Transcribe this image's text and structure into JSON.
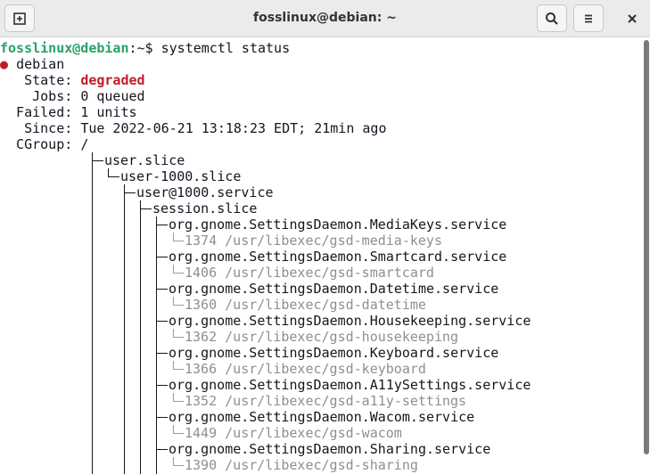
{
  "window": {
    "title": "fosslinux@debian: ~"
  },
  "terminal": {
    "prompt_user": "fosslinux@debian",
    "prompt_suffix": ":~$ ",
    "command": "systemctl status",
    "host_line": "debian",
    "status_fields": [
      {
        "label": "   State: ",
        "value": "degraded"
      },
      {
        "label": "    Jobs: ",
        "value": "0 queued"
      },
      {
        "label": "  Failed: ",
        "value": "1 units"
      },
      {
        "label": "   Since: ",
        "value": "Tue 2022-06-21 13:18:23 EDT; 21min ago"
      },
      {
        "label": "  CGroup: ",
        "value": "/"
      }
    ],
    "tree": {
      "user_slice": "user.slice",
      "user_1000_slice": "user-1000.slice",
      "user_service": "user@1000.service",
      "session_slice": "session.slice",
      "services": [
        {
          "name": "org.gnome.SettingsDaemon.MediaKeys.service",
          "pid": "1374",
          "cmd": "/usr/libexec/gsd-media-keys"
        },
        {
          "name": "org.gnome.SettingsDaemon.Smartcard.service",
          "pid": "1406",
          "cmd": "/usr/libexec/gsd-smartcard"
        },
        {
          "name": "org.gnome.SettingsDaemon.Datetime.service",
          "pid": "1360",
          "cmd": "/usr/libexec/gsd-datetime"
        },
        {
          "name": "org.gnome.SettingsDaemon.Housekeeping.service",
          "pid": "1362",
          "cmd": "/usr/libexec/gsd-housekeeping"
        },
        {
          "name": "org.gnome.SettingsDaemon.Keyboard.service",
          "pid": "1366",
          "cmd": "/usr/libexec/gsd-keyboard"
        },
        {
          "name": "org.gnome.SettingsDaemon.A11ySettings.service",
          "pid": "1352",
          "cmd": "/usr/libexec/gsd-a11y-settings"
        },
        {
          "name": "org.gnome.SettingsDaemon.Wacom.service",
          "pid": "1449",
          "cmd": "/usr/libexec/gsd-wacom"
        },
        {
          "name": "org.gnome.SettingsDaemon.Sharing.service",
          "pid": "1390",
          "cmd": "/usr/libexec/gsd-sharing"
        }
      ]
    }
  },
  "icons": {
    "new_tab": "new-tab-icon",
    "search": "search-icon",
    "menu": "hamburger-menu-icon",
    "close": "close-icon"
  },
  "colors": {
    "prompt_user": "#26a269",
    "degraded": "#c01c28",
    "status_dot": "#c01c28",
    "process_text": "#8f8f8f"
  }
}
